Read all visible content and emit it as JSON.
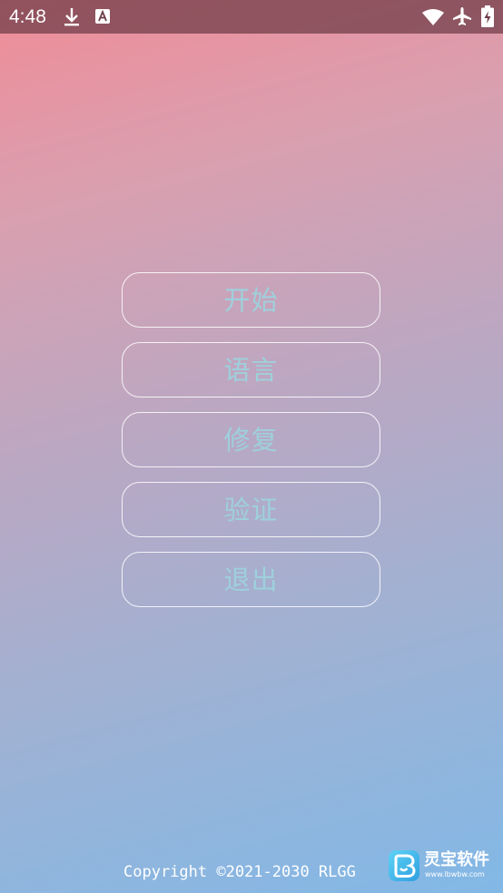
{
  "status_bar": {
    "time": "4:48",
    "icons": [
      "download-icon",
      "a-badge-icon",
      "wifi-icon",
      "airplane-mode-icon",
      "battery-charging-icon"
    ]
  },
  "menu": {
    "buttons": [
      {
        "label": "开始"
      },
      {
        "label": "语言"
      },
      {
        "label": "修复"
      },
      {
        "label": "验证"
      },
      {
        "label": "退出"
      }
    ],
    "text_color": "#9ed0dc",
    "border_color": "#ffffff"
  },
  "footer": {
    "copyright": "Copyright ©2021-2030 RLGG"
  },
  "watermark": {
    "name": "灵宝软件",
    "site": "www.lbwbw.com",
    "logo_icon": "lingbao-logo-icon"
  },
  "colors": {
    "gradient_top": "#f08c98",
    "gradient_bottom": "#82b8e6",
    "status_bar": "#6e3c46"
  }
}
